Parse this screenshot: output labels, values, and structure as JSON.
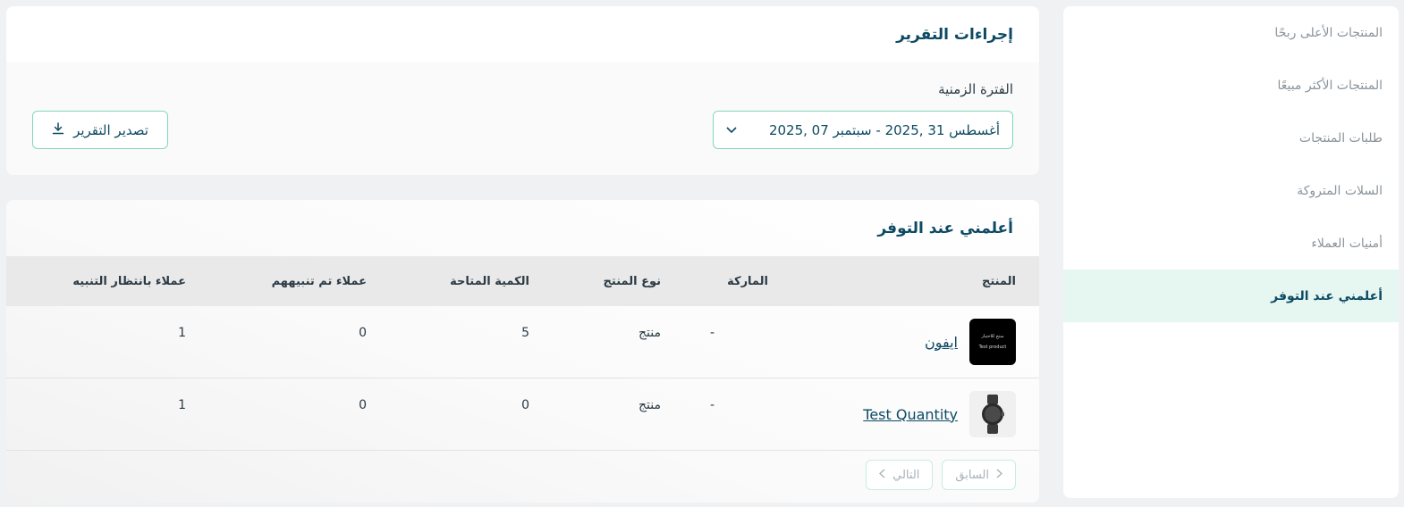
{
  "sidebar": {
    "items": [
      {
        "label": "المنتجات الأعلى ربحًا"
      },
      {
        "label": "المنتجات الأكثر مبيعًا"
      },
      {
        "label": "طلبات المنتجات"
      },
      {
        "label": "السلات المتروكة"
      },
      {
        "label": "أمنيات العملاء"
      },
      {
        "label": "أعلمني عند التوفر",
        "active": true
      }
    ]
  },
  "actions": {
    "title": "إجراءات التقرير",
    "period_label": "الفترة الزمنية",
    "date_range": "أغسطس 31 ,2025  -  سبتمبر 07 ,2025",
    "export_label": "تصدير التقرير"
  },
  "notify": {
    "title": "أعلمني عند التوفر",
    "columns": [
      "المنتج",
      "الماركة",
      "نوع المنتج",
      "الكمية المتاحة",
      "عملاء تم تنبيههم",
      "عملاء بانتظار التنبيه"
    ],
    "rows": [
      {
        "product": "ايفون",
        "thumb_text_1": "منتج للاختبار",
        "thumb_text_2": "Test product",
        "brand": "-",
        "type": "منتج",
        "qty": "5",
        "notified": "0",
        "waiting": "1"
      },
      {
        "product": "Test Quantity",
        "brand": "-",
        "type": "منتج",
        "qty": "0",
        "notified": "0",
        "waiting": "1"
      }
    ],
    "pager": {
      "prev": "السابق",
      "next": "التالي"
    }
  },
  "icons": {
    "export": "download-icon",
    "chevron": "chevron-down-icon",
    "watch": "watch-icon"
  },
  "colors": {
    "brand": "#0c4a63",
    "accent_border": "#7ed8c2",
    "active_bg": "#e6f6f1"
  }
}
